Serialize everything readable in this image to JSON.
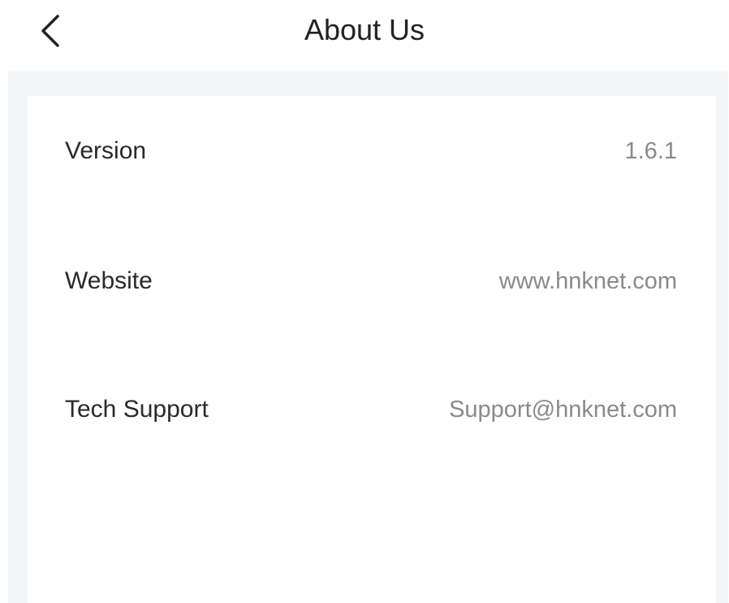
{
  "header": {
    "title": "About Us",
    "back_icon": "chevron-left-icon"
  },
  "about": {
    "rows": [
      {
        "label": "Version",
        "value": "1.6.1"
      },
      {
        "label": "Website",
        "value": "www.hnknet.com"
      },
      {
        "label": "Tech Support",
        "value": "Support@hnknet.com"
      }
    ]
  },
  "colors": {
    "background": "#ffffff",
    "content_background": "#f4f5f7",
    "label_text": "#2a2a2a",
    "value_text": "#8a8a8a"
  }
}
